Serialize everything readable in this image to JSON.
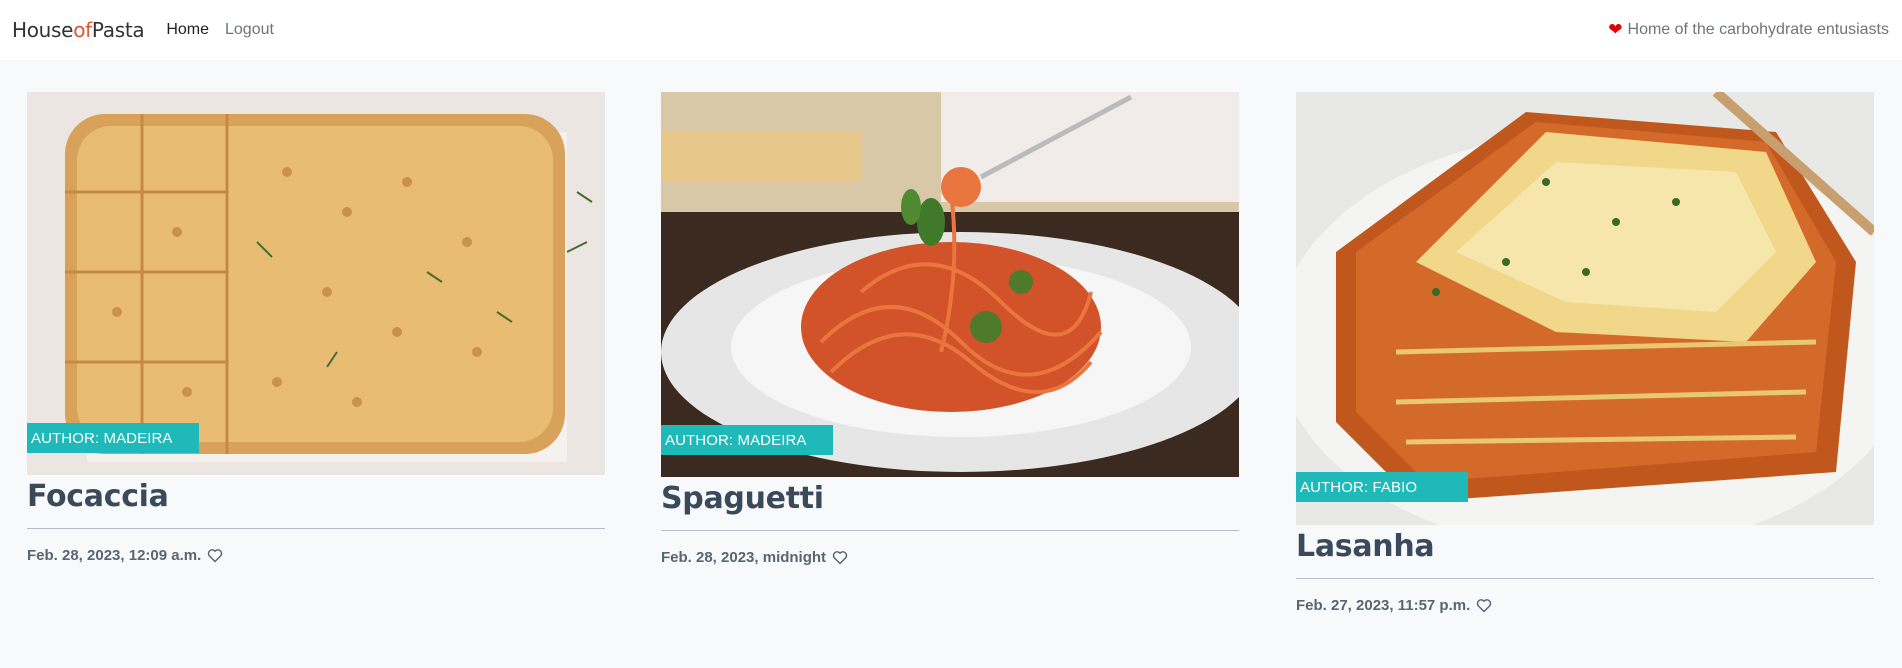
{
  "brand": {
    "part1": "House",
    "part2": "of",
    "part3": "Pasta"
  },
  "nav": {
    "home": "Home",
    "logout": "Logout"
  },
  "tagline": "Home of the carbohydrate entusiasts",
  "colors": {
    "accent": "#20b9ba",
    "brand_of": "#e0562f",
    "heart": "#e00000"
  },
  "posts": [
    {
      "author": "AUTHOR: MADEIRA",
      "title": "Focaccia",
      "date": "Feb. 28, 2023, 12:09 a.m.",
      "image_icon": "focaccia-photo"
    },
    {
      "author": "AUTHOR: MADEIRA",
      "title": "Spaguetti",
      "date": "Feb. 28, 2023, midnight",
      "image_icon": "spaghetti-photo"
    },
    {
      "author": "AUTHOR: FABIO",
      "title": "Lasanha",
      "date": "Feb. 27, 2023, 11:57 p.m.",
      "image_icon": "lasagna-photo"
    }
  ]
}
